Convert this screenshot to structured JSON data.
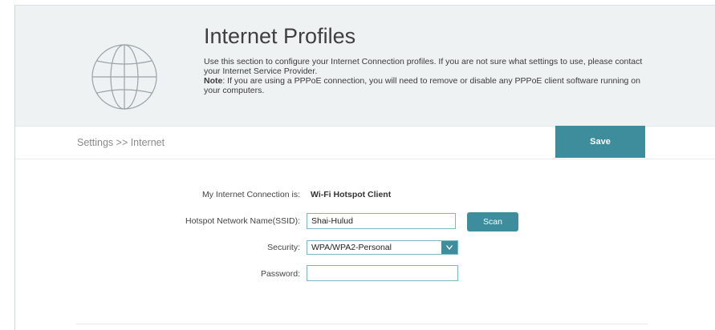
{
  "header": {
    "title": "Internet Profiles",
    "description_1": "Use this section to configure your Internet Connection profiles. If you are not sure what settings to use, please contact your Internet Service Provider.",
    "note_label": "Note",
    "note_text": ": If you are using a PPPoE connection, you will need to remove or disable any PPPoE client software running on your computers.",
    "icon": "globe-icon"
  },
  "breadcrumb": {
    "text": "Settings >> Internet"
  },
  "toolbar": {
    "save_label": "Save"
  },
  "form": {
    "connection": {
      "label": "My Internet Connection is:",
      "value": "Wi-Fi Hotspot Client"
    },
    "ssid": {
      "label": "Hotspot Network Name(SSID):",
      "value": "Shai-Hulud"
    },
    "scan_label": "Scan",
    "security": {
      "label": "Security:",
      "value": "WPA/WPA2-Personal",
      "arrow_icon": "chevron-down-icon"
    },
    "password": {
      "label": "Password:",
      "value": ""
    }
  },
  "colors": {
    "accent": "#3d8d9c",
    "header_bg": "#eef2f2",
    "input_border": "#7bb7c3"
  }
}
